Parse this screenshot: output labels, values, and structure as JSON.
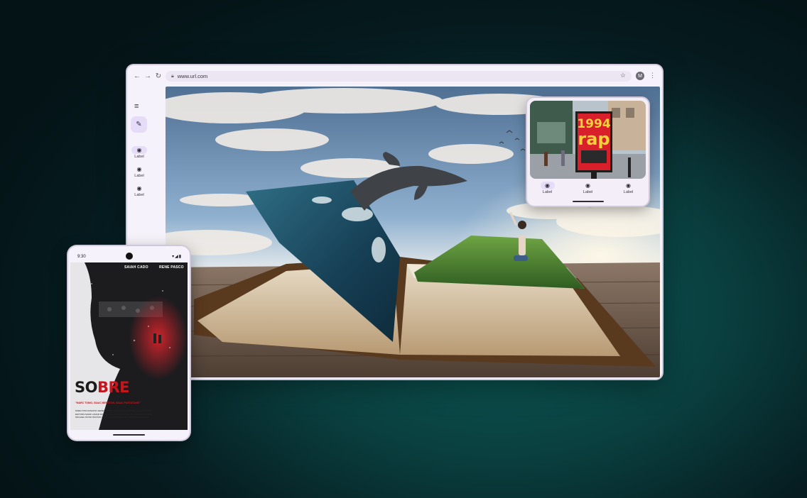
{
  "browser": {
    "url": "www.url.com",
    "profile_initial": "M",
    "icons": {
      "back": "arrow-left-icon",
      "forward": "arrow-right-icon",
      "reload": "reload-icon",
      "lock": "lock-icon",
      "bookmark": "star-icon",
      "more": "more-vert-icon"
    },
    "rail": {
      "menu_icon": "menu-icon",
      "fab_icon": "edit-pencil-icon",
      "items": [
        {
          "label": "Label",
          "active": true
        },
        {
          "label": "Label",
          "active": false
        },
        {
          "label": "Label",
          "active": false
        }
      ]
    },
    "hero_image": "open book with whale leaping from ocean page and man taking selfie on grass page"
  },
  "mini_window": {
    "poster_text_top": "1994",
    "poster_text_bottom": "rap",
    "nav": [
      {
        "label": "Label",
        "active": true
      },
      {
        "label": "Label",
        "active": false
      },
      {
        "label": "Label",
        "active": false
      }
    ]
  },
  "phone": {
    "time": "9:30",
    "poster": {
      "name_left": "SAIAH CADO",
      "name_right": "RENE PASCO",
      "title_part1": "SO",
      "title_part2": "BRE",
      "tagline": "\"MARC TONIO, ISAAC BENSTON, ISAAC PASTATANIS\"",
      "credits": "DIRECTOR DONATAN JEWEY DIRECTOR OF PHOTOGRAPHY ELIAS TIMBO EDITORS MARK LAMAR DON BENITO LORNE ELADE ANN JAMERSON RENE MICHAEL MUSIC BASTAN LEWIS POSTER DESIGN ANDREW DIAMONDS"
    }
  },
  "colors": {
    "accent_pill": "#e5dcf7",
    "frame": "#f6f2fb",
    "poster_red": "#c4161c",
    "background": "#0a3f3f"
  }
}
